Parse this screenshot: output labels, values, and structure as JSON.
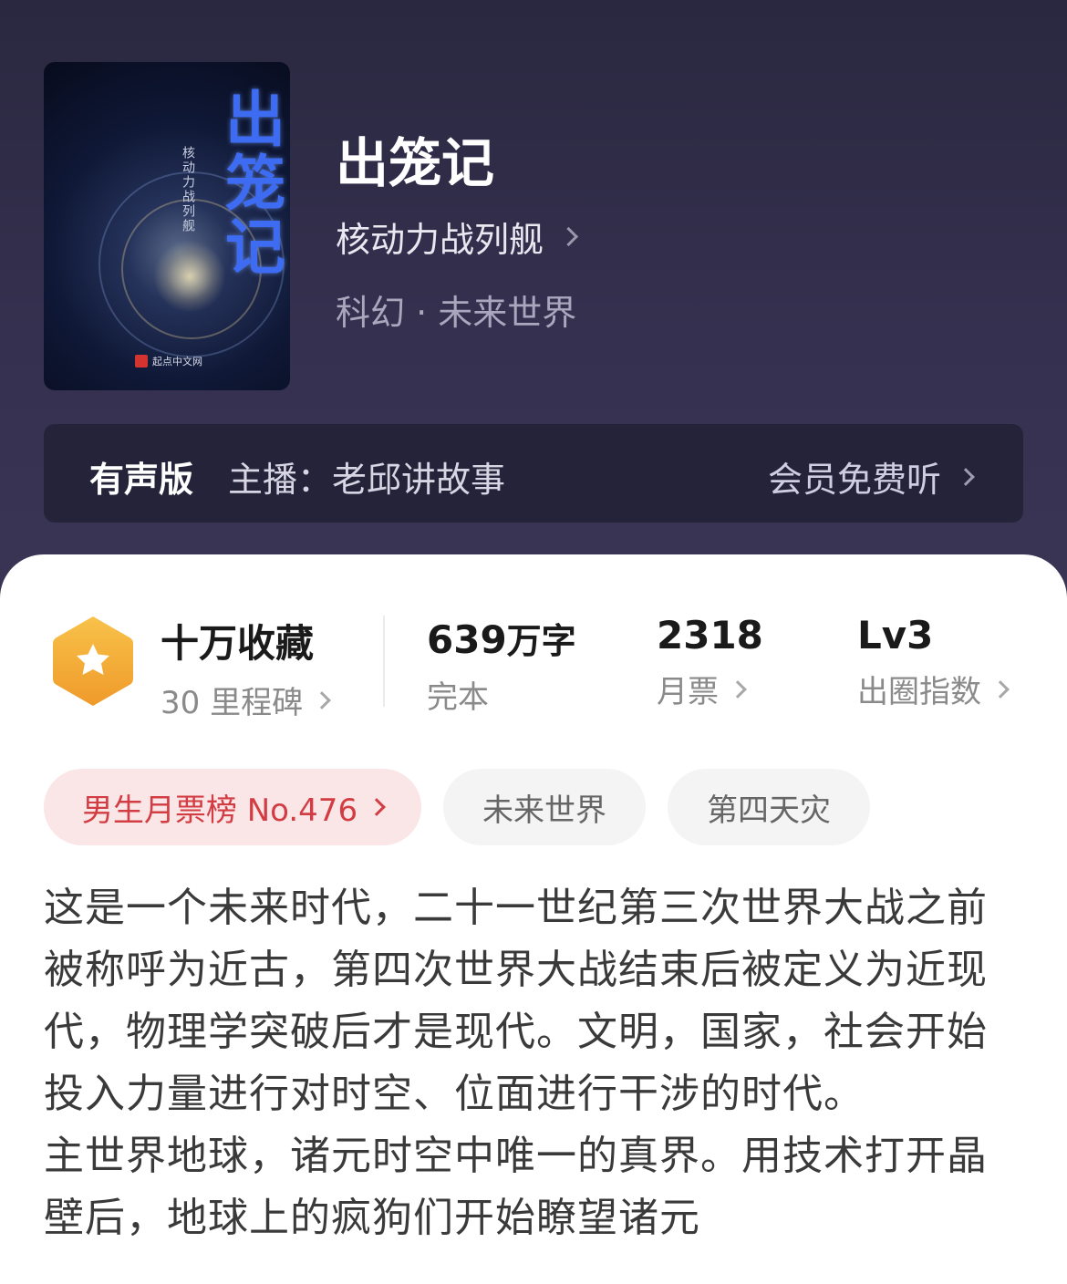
{
  "book": {
    "title": "出笼记",
    "author": "核动力战列舰",
    "genre": "科幻 · 未来世界",
    "cover_title": "出笼记",
    "cover_author": "核动力战列舰",
    "cover_publisher": "起点中文网"
  },
  "audio": {
    "label": "有声版",
    "host": "主播：老邱讲故事",
    "action": "会员免费听"
  },
  "stats": {
    "favorites": {
      "value": "十万收藏",
      "sub": "30 里程碑"
    },
    "words": {
      "value": "639",
      "unit": "万字",
      "sub": "完本"
    },
    "monthly": {
      "value": "2318",
      "sub": "月票"
    },
    "level": {
      "value": "Lv3",
      "sub": "出圈指数"
    }
  },
  "tags": {
    "rank": "男生月票榜 No.476",
    "tag1": "未来世界",
    "tag2": "第四天灾"
  },
  "description": {
    "para1": "这是一个未来时代，二十一世纪第三次世界大战之前被称呼为近古，第四次世界大战结束后被定义为近现代，物理学突破后才是现代。文明，国家，社会开始投入力量进行对时空、位面进行干涉的时代。",
    "para2": "主世界地球，诸元时空中唯一的真界。用技术打开晶壁后，地球上的疯狗们开始瞭望诸元"
  },
  "colors": {
    "header_bg": "#2e2b45",
    "accent_red": "#d23d43",
    "badge_orange": "#f3a93a"
  }
}
